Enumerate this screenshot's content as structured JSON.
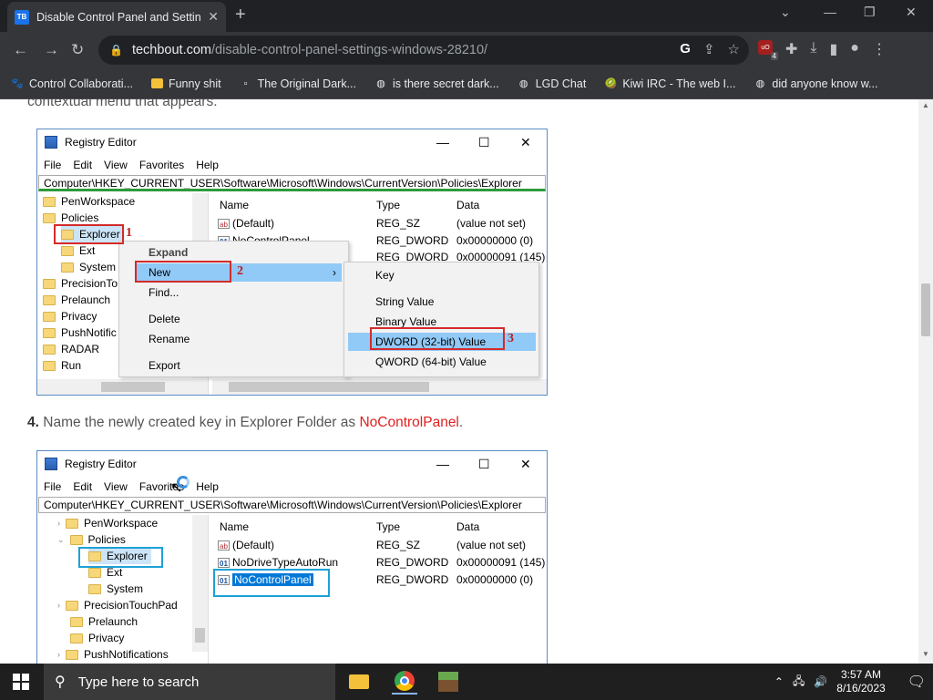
{
  "browser": {
    "tab_title": "Disable Control Panel and Setting",
    "tab_favicon": "TB",
    "url_domain": "techbout.com",
    "url_path": "/disable-control-panel-settings-windows-28210/",
    "ext_badge": "4",
    "bookmarks": [
      {
        "label": "Control Collaborati...",
        "icon": "bookmark-site-icon"
      },
      {
        "label": "Funny shit",
        "icon": "folder-icon"
      },
      {
        "label": "The Original Dark...",
        "icon": "blank-page-icon"
      },
      {
        "label": "is there secret dark...",
        "icon": "globe-icon"
      },
      {
        "label": "LGD Chat",
        "icon": "globe-icon"
      },
      {
        "label": "Kiwi IRC - The web I...",
        "icon": "kiwi-icon"
      },
      {
        "label": "did anyone know w...",
        "icon": "globe-icon"
      }
    ]
  },
  "article": {
    "top_fragment": "contextual menu that appears.",
    "step4_num": "4.",
    "step4_text": "Name the newly created key in Explorer Folder as",
    "step4_key": "NoControlPanel",
    "step4_end": "."
  },
  "regedit1": {
    "title": "Registry Editor",
    "menu": [
      "File",
      "Edit",
      "View",
      "Favorites",
      "Help"
    ],
    "address": "Computer\\HKEY_CURRENT_USER\\Software\\Microsoft\\Windows\\CurrentVersion\\Policies\\Explorer",
    "tree": [
      "PenWorkspace",
      "Policies",
      "Explorer",
      "Ext",
      "System",
      "PrecisionTo",
      "Prelaunch",
      "Privacy",
      "PushNotific",
      "RADAR",
      "Run"
    ],
    "columns": [
      "Name",
      "Type",
      "Data"
    ],
    "rows": [
      {
        "name": "(Default)",
        "type": "REG_SZ",
        "data": "(value not set)"
      },
      {
        "name": "NoControlPanel",
        "type": "REG_DWORD",
        "data": "0x00000000 (0)"
      },
      {
        "name": "",
        "type": "REG_DWORD",
        "data": "0x00000091 (145)"
      }
    ],
    "context_menu": [
      "Expand",
      "New",
      "Find...",
      "Delete",
      "Rename",
      "Export"
    ],
    "submenu": [
      "Key",
      "String Value",
      "Binary Value",
      "DWORD (32-bit) Value",
      "QWORD (64-bit) Value"
    ],
    "markers": [
      "1",
      "2",
      "3"
    ]
  },
  "regedit2": {
    "title": "Registry Editor",
    "menu": [
      "File",
      "Edit",
      "View",
      "Favorites",
      "Help"
    ],
    "address": "Computer\\HKEY_CURRENT_USER\\Software\\Microsoft\\Windows\\CurrentVersion\\Policies\\Explorer",
    "tree": [
      "PenWorkspace",
      "Policies",
      "Explorer",
      "Ext",
      "System",
      "PrecisionTouchPad",
      "Prelaunch",
      "Privacy",
      "PushNotifications"
    ],
    "columns": [
      "Name",
      "Type",
      "Data"
    ],
    "rows": [
      {
        "name": "(Default)",
        "type": "REG_SZ",
        "data": "(value not set)"
      },
      {
        "name": "NoDriveTypeAutoRun",
        "type": "REG_DWORD",
        "data": "0x00000091 (145)"
      },
      {
        "name": "NoControlPanel",
        "type": "REG_DWORD",
        "data": "0x00000000 (0)"
      }
    ]
  },
  "taskbar": {
    "search_placeholder": "Type here to search",
    "time": "3:57 AM",
    "date": "8/16/2023"
  },
  "colors": {
    "accent_red": "#d42a2a",
    "accent_blue": "#1da1d6",
    "highlight": "#91c9f7",
    "chrome_dark": "#202124"
  }
}
